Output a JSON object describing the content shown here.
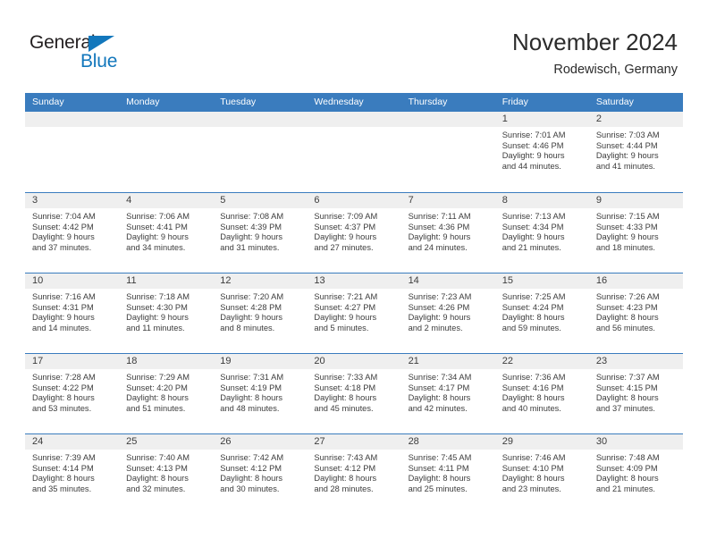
{
  "brand": {
    "name_part1": "General",
    "name_part2": "Blue",
    "accent_color": "#1277bc",
    "triangle_icon": "triangle-logo-icon"
  },
  "header": {
    "title": "November 2024",
    "subtitle": "Rodewisch, Germany"
  },
  "theme": {
    "header_blue": "#3a7cbe",
    "date_band": "#efefef",
    "text": "#3c3c3c"
  },
  "weekdays": [
    "Sunday",
    "Monday",
    "Tuesday",
    "Wednesday",
    "Thursday",
    "Friday",
    "Saturday"
  ],
  "weeks": [
    [
      {
        "date": "",
        "empty": true
      },
      {
        "date": "",
        "empty": true
      },
      {
        "date": "",
        "empty": true
      },
      {
        "date": "",
        "empty": true
      },
      {
        "date": "",
        "empty": true
      },
      {
        "date": "1",
        "sunrise": "Sunrise: 7:01 AM",
        "sunset": "Sunset: 4:46 PM",
        "daylight1": "Daylight: 9 hours",
        "daylight2": "and 44 minutes."
      },
      {
        "date": "2",
        "sunrise": "Sunrise: 7:03 AM",
        "sunset": "Sunset: 4:44 PM",
        "daylight1": "Daylight: 9 hours",
        "daylight2": "and 41 minutes."
      }
    ],
    [
      {
        "date": "3",
        "sunrise": "Sunrise: 7:04 AM",
        "sunset": "Sunset: 4:42 PM",
        "daylight1": "Daylight: 9 hours",
        "daylight2": "and 37 minutes."
      },
      {
        "date": "4",
        "sunrise": "Sunrise: 7:06 AM",
        "sunset": "Sunset: 4:41 PM",
        "daylight1": "Daylight: 9 hours",
        "daylight2": "and 34 minutes."
      },
      {
        "date": "5",
        "sunrise": "Sunrise: 7:08 AM",
        "sunset": "Sunset: 4:39 PM",
        "daylight1": "Daylight: 9 hours",
        "daylight2": "and 31 minutes."
      },
      {
        "date": "6",
        "sunrise": "Sunrise: 7:09 AM",
        "sunset": "Sunset: 4:37 PM",
        "daylight1": "Daylight: 9 hours",
        "daylight2": "and 27 minutes."
      },
      {
        "date": "7",
        "sunrise": "Sunrise: 7:11 AM",
        "sunset": "Sunset: 4:36 PM",
        "daylight1": "Daylight: 9 hours",
        "daylight2": "and 24 minutes."
      },
      {
        "date": "8",
        "sunrise": "Sunrise: 7:13 AM",
        "sunset": "Sunset: 4:34 PM",
        "daylight1": "Daylight: 9 hours",
        "daylight2": "and 21 minutes."
      },
      {
        "date": "9",
        "sunrise": "Sunrise: 7:15 AM",
        "sunset": "Sunset: 4:33 PM",
        "daylight1": "Daylight: 9 hours",
        "daylight2": "and 18 minutes."
      }
    ],
    [
      {
        "date": "10",
        "sunrise": "Sunrise: 7:16 AM",
        "sunset": "Sunset: 4:31 PM",
        "daylight1": "Daylight: 9 hours",
        "daylight2": "and 14 minutes."
      },
      {
        "date": "11",
        "sunrise": "Sunrise: 7:18 AM",
        "sunset": "Sunset: 4:30 PM",
        "daylight1": "Daylight: 9 hours",
        "daylight2": "and 11 minutes."
      },
      {
        "date": "12",
        "sunrise": "Sunrise: 7:20 AM",
        "sunset": "Sunset: 4:28 PM",
        "daylight1": "Daylight: 9 hours",
        "daylight2": "and 8 minutes."
      },
      {
        "date": "13",
        "sunrise": "Sunrise: 7:21 AM",
        "sunset": "Sunset: 4:27 PM",
        "daylight1": "Daylight: 9 hours",
        "daylight2": "and 5 minutes."
      },
      {
        "date": "14",
        "sunrise": "Sunrise: 7:23 AM",
        "sunset": "Sunset: 4:26 PM",
        "daylight1": "Daylight: 9 hours",
        "daylight2": "and 2 minutes."
      },
      {
        "date": "15",
        "sunrise": "Sunrise: 7:25 AM",
        "sunset": "Sunset: 4:24 PM",
        "daylight1": "Daylight: 8 hours",
        "daylight2": "and 59 minutes."
      },
      {
        "date": "16",
        "sunrise": "Sunrise: 7:26 AM",
        "sunset": "Sunset: 4:23 PM",
        "daylight1": "Daylight: 8 hours",
        "daylight2": "and 56 minutes."
      }
    ],
    [
      {
        "date": "17",
        "sunrise": "Sunrise: 7:28 AM",
        "sunset": "Sunset: 4:22 PM",
        "daylight1": "Daylight: 8 hours",
        "daylight2": "and 53 minutes."
      },
      {
        "date": "18",
        "sunrise": "Sunrise: 7:29 AM",
        "sunset": "Sunset: 4:20 PM",
        "daylight1": "Daylight: 8 hours",
        "daylight2": "and 51 minutes."
      },
      {
        "date": "19",
        "sunrise": "Sunrise: 7:31 AM",
        "sunset": "Sunset: 4:19 PM",
        "daylight1": "Daylight: 8 hours",
        "daylight2": "and 48 minutes."
      },
      {
        "date": "20",
        "sunrise": "Sunrise: 7:33 AM",
        "sunset": "Sunset: 4:18 PM",
        "daylight1": "Daylight: 8 hours",
        "daylight2": "and 45 minutes."
      },
      {
        "date": "21",
        "sunrise": "Sunrise: 7:34 AM",
        "sunset": "Sunset: 4:17 PM",
        "daylight1": "Daylight: 8 hours",
        "daylight2": "and 42 minutes."
      },
      {
        "date": "22",
        "sunrise": "Sunrise: 7:36 AM",
        "sunset": "Sunset: 4:16 PM",
        "daylight1": "Daylight: 8 hours",
        "daylight2": "and 40 minutes."
      },
      {
        "date": "23",
        "sunrise": "Sunrise: 7:37 AM",
        "sunset": "Sunset: 4:15 PM",
        "daylight1": "Daylight: 8 hours",
        "daylight2": "and 37 minutes."
      }
    ],
    [
      {
        "date": "24",
        "sunrise": "Sunrise: 7:39 AM",
        "sunset": "Sunset: 4:14 PM",
        "daylight1": "Daylight: 8 hours",
        "daylight2": "and 35 minutes."
      },
      {
        "date": "25",
        "sunrise": "Sunrise: 7:40 AM",
        "sunset": "Sunset: 4:13 PM",
        "daylight1": "Daylight: 8 hours",
        "daylight2": "and 32 minutes."
      },
      {
        "date": "26",
        "sunrise": "Sunrise: 7:42 AM",
        "sunset": "Sunset: 4:12 PM",
        "daylight1": "Daylight: 8 hours",
        "daylight2": "and 30 minutes."
      },
      {
        "date": "27",
        "sunrise": "Sunrise: 7:43 AM",
        "sunset": "Sunset: 4:12 PM",
        "daylight1": "Daylight: 8 hours",
        "daylight2": "and 28 minutes."
      },
      {
        "date": "28",
        "sunrise": "Sunrise: 7:45 AM",
        "sunset": "Sunset: 4:11 PM",
        "daylight1": "Daylight: 8 hours",
        "daylight2": "and 25 minutes."
      },
      {
        "date": "29",
        "sunrise": "Sunrise: 7:46 AM",
        "sunset": "Sunset: 4:10 PM",
        "daylight1": "Daylight: 8 hours",
        "daylight2": "and 23 minutes."
      },
      {
        "date": "30",
        "sunrise": "Sunrise: 7:48 AM",
        "sunset": "Sunset: 4:09 PM",
        "daylight1": "Daylight: 8 hours",
        "daylight2": "and 21 minutes."
      }
    ]
  ]
}
